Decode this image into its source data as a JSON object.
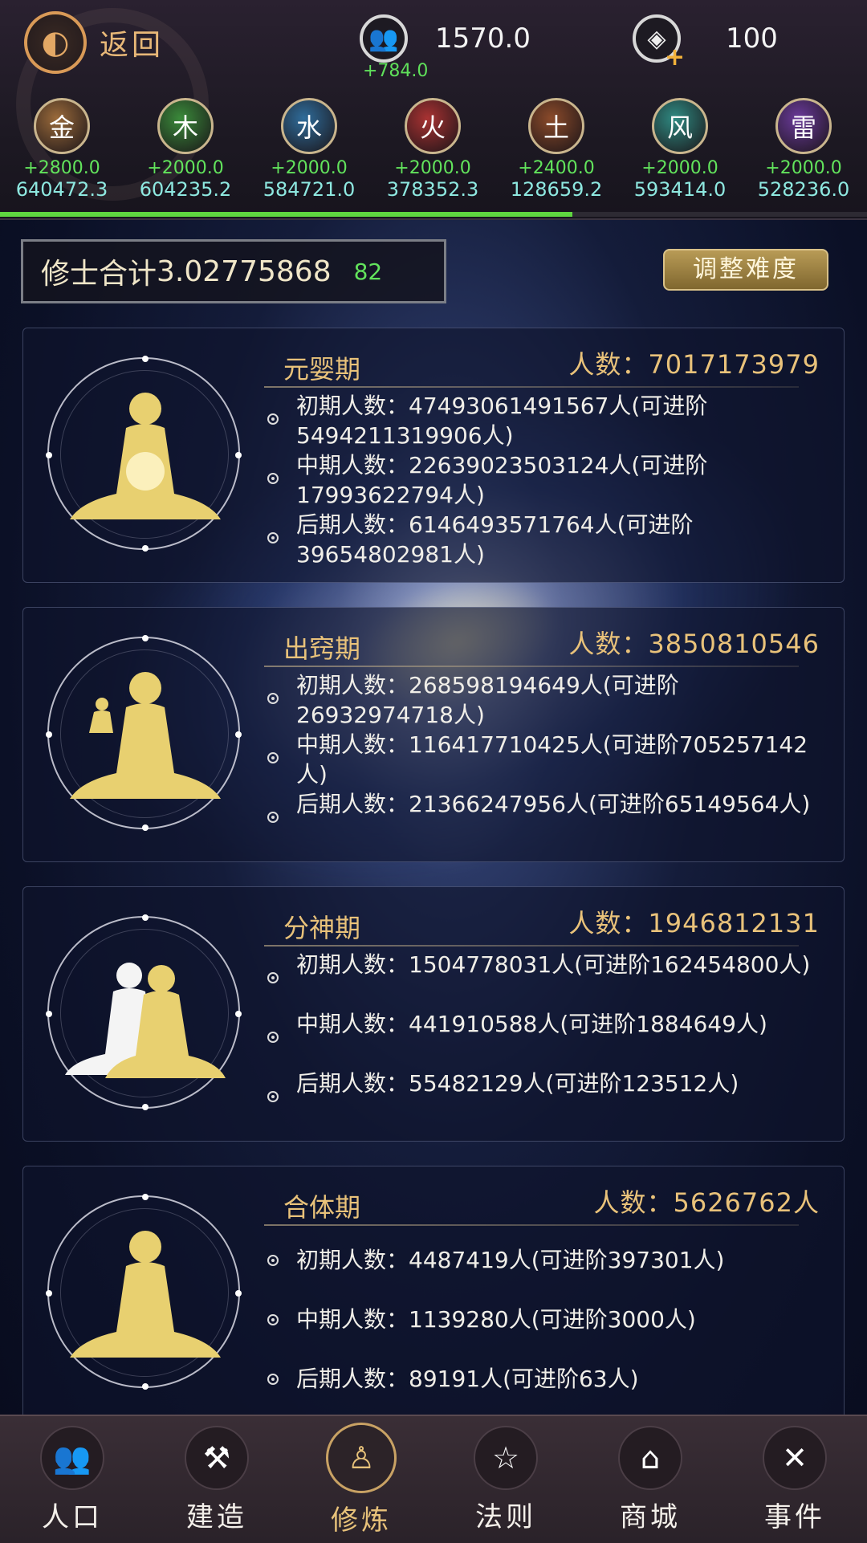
{
  "header": {
    "back_label": "返回",
    "population": {
      "value": "1570.0",
      "delta": "+784.0"
    },
    "currency": {
      "value": "100"
    }
  },
  "elements": [
    {
      "name": "金",
      "delta": "+2800.0",
      "total": "640472.3",
      "color": "#9a6a3a"
    },
    {
      "name": "木",
      "delta": "+2000.0",
      "total": "604235.2",
      "color": "#3a8a3a"
    },
    {
      "name": "水",
      "delta": "+2000.0",
      "total": "584721.0",
      "color": "#2f6c9a"
    },
    {
      "name": "火",
      "delta": "+2000.0",
      "total": "378352.3",
      "color": "#a83232"
    },
    {
      "name": "土",
      "delta": "+2400.0",
      "total": "128659.2",
      "color": "#8a4a2a"
    },
    {
      "name": "风",
      "delta": "+2000.0",
      "total": "593414.0",
      "color": "#2f8a82"
    },
    {
      "name": "雷",
      "delta": "+2000.0",
      "total": "528236.0",
      "color": "#6a3a9a"
    }
  ],
  "progress": 0.66,
  "summary": {
    "label": "修士合计",
    "value": "3.02775868",
    "badge": "82"
  },
  "adjust_label": "调整难度",
  "stages": [
    {
      "name": "元婴期",
      "count": "人数：7017173979",
      "rows": [
        "初期人数：47493061491567人(可进阶5494211319906人)",
        "中期人数：22639023503124人(可进阶17993622794人)",
        "后期人数：6146493571764人(可进阶39654802981人)"
      ]
    },
    {
      "name": "出窍期",
      "count": "人数：3850810546",
      "rows": [
        "初期人数：268598194649人(可进阶26932974718人)",
        "中期人数：116417710425人(可进阶705257142人)",
        "后期人数：21366247956人(可进阶65149564人)"
      ]
    },
    {
      "name": "分神期",
      "count": "人数：1946812131",
      "rows": [
        "初期人数：1504778031人(可进阶162454800人)",
        "中期人数：441910588人(可进阶1884649人)",
        "后期人数：55482129人(可进阶123512人)"
      ]
    },
    {
      "name": "合体期",
      "count": "人数：5626762人",
      "rows": [
        "初期人数：4487419人(可进阶397301人)",
        "中期人数：1139280人(可进阶3000人)",
        "后期人数：89191人(可进阶63人)"
      ]
    }
  ],
  "nav": [
    {
      "label": "人口",
      "icon": "people-icon"
    },
    {
      "label": "建造",
      "icon": "hammer-wrench-icon"
    },
    {
      "label": "修炼",
      "icon": "meditation-icon",
      "active": true
    },
    {
      "label": "法则",
      "icon": "scroll-star-icon"
    },
    {
      "label": "商城",
      "icon": "shop-icon"
    },
    {
      "label": "事件",
      "icon": "book-swords-icon"
    }
  ]
}
